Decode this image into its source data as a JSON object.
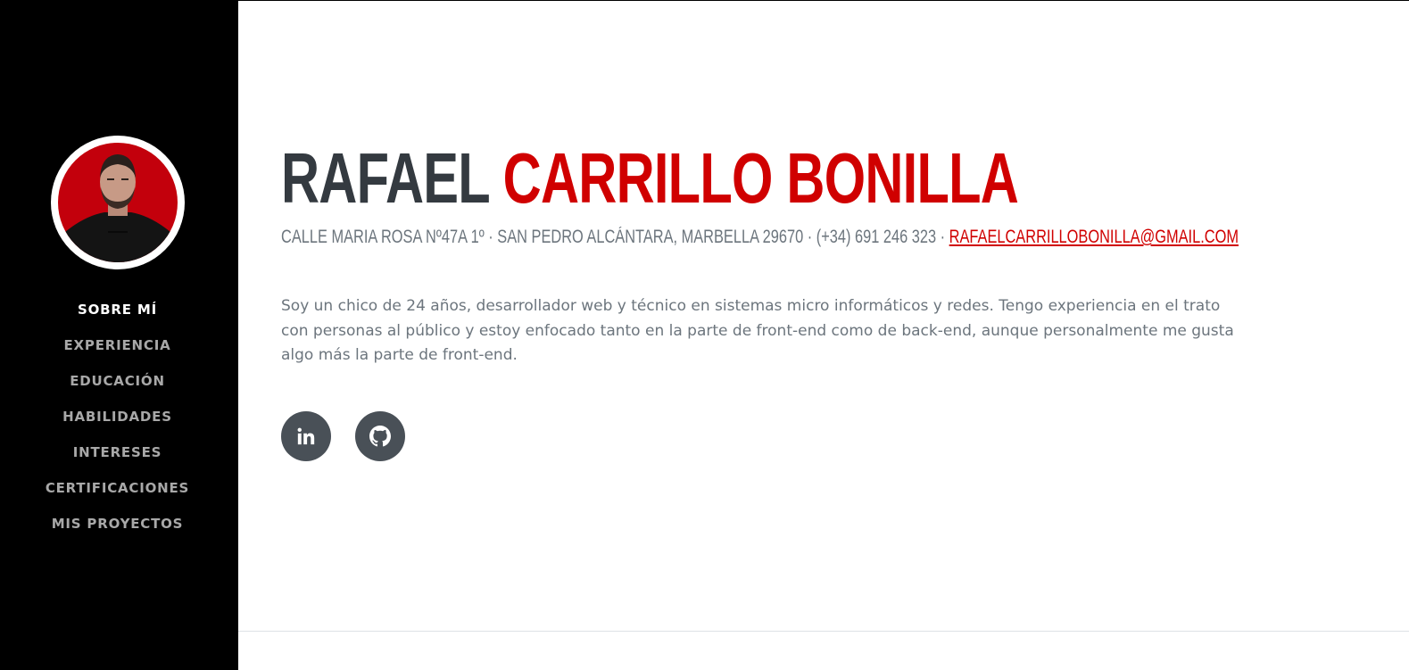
{
  "sidebar": {
    "nav": [
      {
        "label": "SOBRE MÍ",
        "active": true
      },
      {
        "label": "EXPERIENCIA",
        "active": false
      },
      {
        "label": "EDUCACIÓN",
        "active": false
      },
      {
        "label": "HABILIDADES",
        "active": false
      },
      {
        "label": "INTERESES",
        "active": false
      },
      {
        "label": "CERTIFICACIONES",
        "active": false
      },
      {
        "label": "MIS PROYECTOS",
        "active": false
      }
    ]
  },
  "header": {
    "first_name": "RAFAEL",
    "last_name": "CARRILLO BONILLA",
    "address": "CALLE MARIA ROSA Nº47A 1º · SAN PEDRO ALCÁNTARA, MARBELLA 29670 · (+34) 691 246 323 ·",
    "email": "RAFAELCARRILLOBONILLA@GMAIL.COM"
  },
  "about": {
    "text": "Soy un chico de 24 años, desarrollador web y técnico en sistemas micro informáticos y redes. Tengo experiencia en el trato con personas al público y estoy enfocado tanto en la parte de front-end como de back-end, aunque personalmente me gusta algo más la parte de front-end."
  },
  "social": [
    {
      "icon": "linkedin-icon"
    },
    {
      "icon": "github-icon"
    }
  ],
  "colors": {
    "sidebar_bg": "#000000",
    "accent": "#d00000",
    "name_dark": "#343a40",
    "muted_text": "#6c757d",
    "social_bg": "#495057"
  }
}
